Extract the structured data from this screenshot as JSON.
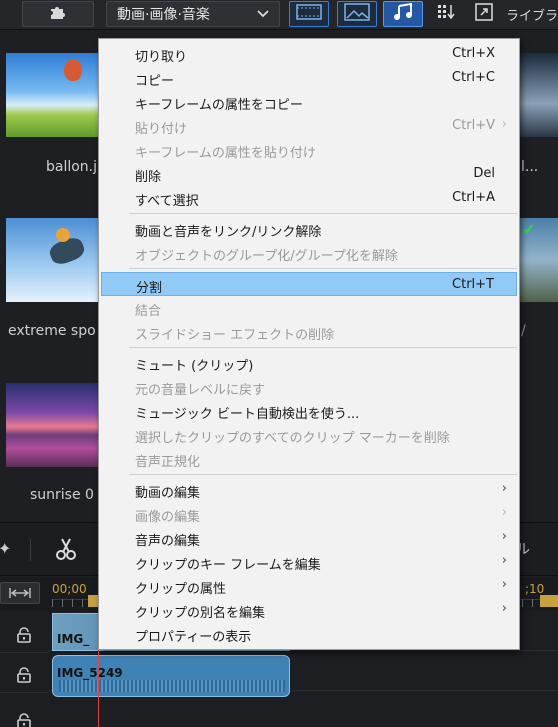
{
  "toolbar": {
    "media_filter": "動画·画像·音楽",
    "library_label": "ライブラリ"
  },
  "library": {
    "items": [
      {
        "caption": "ballon.j"
      },
      {
        "caption": "extreme spo"
      },
      {
        "caption": "sunrise 0"
      },
      {
        "caption": "l..."
      },
      {
        "caption": "/"
      }
    ]
  },
  "timeline": {
    "toolbar_right_label": "ル",
    "time_left": "00;00",
    "time_right": ";10",
    "video_clip_name": "IMG_",
    "audio_clip_name": "IMG_5249"
  },
  "context_menu": {
    "items": [
      {
        "label": "切り取り",
        "shortcut": "Ctrl+X"
      },
      {
        "label": "コピー",
        "shortcut": "Ctrl+C"
      },
      {
        "label": "キーフレームの属性をコピー",
        "shortcut": ""
      },
      {
        "label": "貼り付け",
        "shortcut": "Ctrl+V"
      },
      {
        "label": "キーフレームの属性を貼り付け",
        "shortcut": ""
      },
      {
        "label": "削除",
        "shortcut": "Del"
      },
      {
        "label": "すべて選択",
        "shortcut": "Ctrl+A"
      },
      {
        "label": "動画と音声をリンク/リンク解除",
        "shortcut": ""
      },
      {
        "label": "オブジェクトのグループ化/グループ化を解除",
        "shortcut": ""
      },
      {
        "label": "分割",
        "shortcut": "Ctrl+T"
      },
      {
        "label": "結合",
        "shortcut": ""
      },
      {
        "label": "スライドショー エフェクトの削除",
        "shortcut": ""
      },
      {
        "label": "ミュート (クリップ)",
        "shortcut": ""
      },
      {
        "label": "元の音量レベルに戻す",
        "shortcut": ""
      },
      {
        "label": "ミュージック ビート自動検出を使う...",
        "shortcut": ""
      },
      {
        "label": "選択したクリップのすべてのクリップ マーカーを削除",
        "shortcut": ""
      },
      {
        "label": "音声正規化",
        "shortcut": ""
      },
      {
        "label": "動画の編集",
        "shortcut": ""
      },
      {
        "label": "画像の編集",
        "shortcut": ""
      },
      {
        "label": "音声の編集",
        "shortcut": ""
      },
      {
        "label": "クリップのキー フレームを編集",
        "shortcut": ""
      },
      {
        "label": "クリップの属性",
        "shortcut": ""
      },
      {
        "label": "クリップの別名を編集",
        "shortcut": ""
      },
      {
        "label": "プロパティーの表示",
        "shortcut": ""
      }
    ]
  },
  "colors": {
    "menu_highlight": "#91c9f7",
    "active_view": "#2457a4",
    "timecode": "#c9a23f",
    "playhead": "#e04444",
    "check": "#2fd24c"
  }
}
